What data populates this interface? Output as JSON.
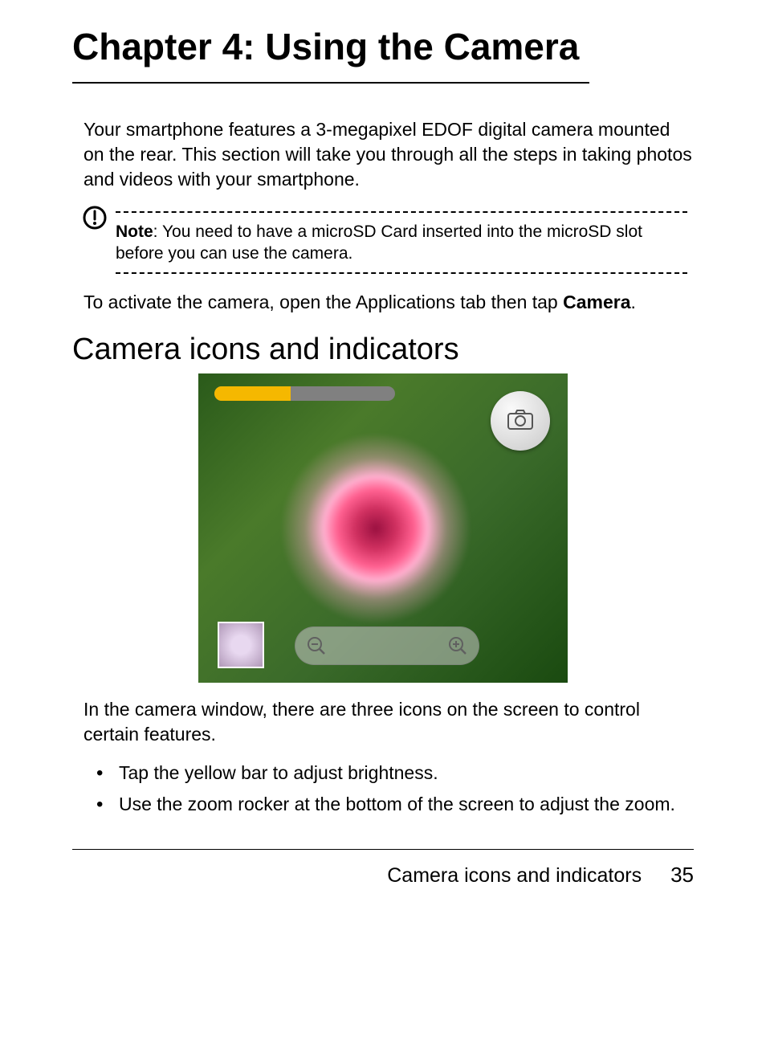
{
  "chapter": {
    "title": "Chapter 4: Using the Camera"
  },
  "intro": "Your smartphone features a 3-megapixel EDOF digital camera mounted on the rear. This section will take you through all the steps in taking photos and videos with your smartphone.",
  "note": {
    "label": "Note",
    "text": ": You need to have a microSD Card inserted into the microSD slot before you can use the camera."
  },
  "activate": {
    "pre": "To activate the camera, open the Applications tab then tap ",
    "bold": "Camera",
    "post": "."
  },
  "section_heading": "Camera icons and indicators",
  "screenshot": {
    "brightness_fill_percent": 42
  },
  "desc": "In the camera window, there are three icons on the screen to control certain features.",
  "bullets": [
    "Tap the yellow bar to adjust brightness.",
    "Use the zoom rocker at the bottom of the screen to adjust the zoom."
  ],
  "footer": {
    "label": "Camera icons and indicators",
    "page": "35"
  }
}
